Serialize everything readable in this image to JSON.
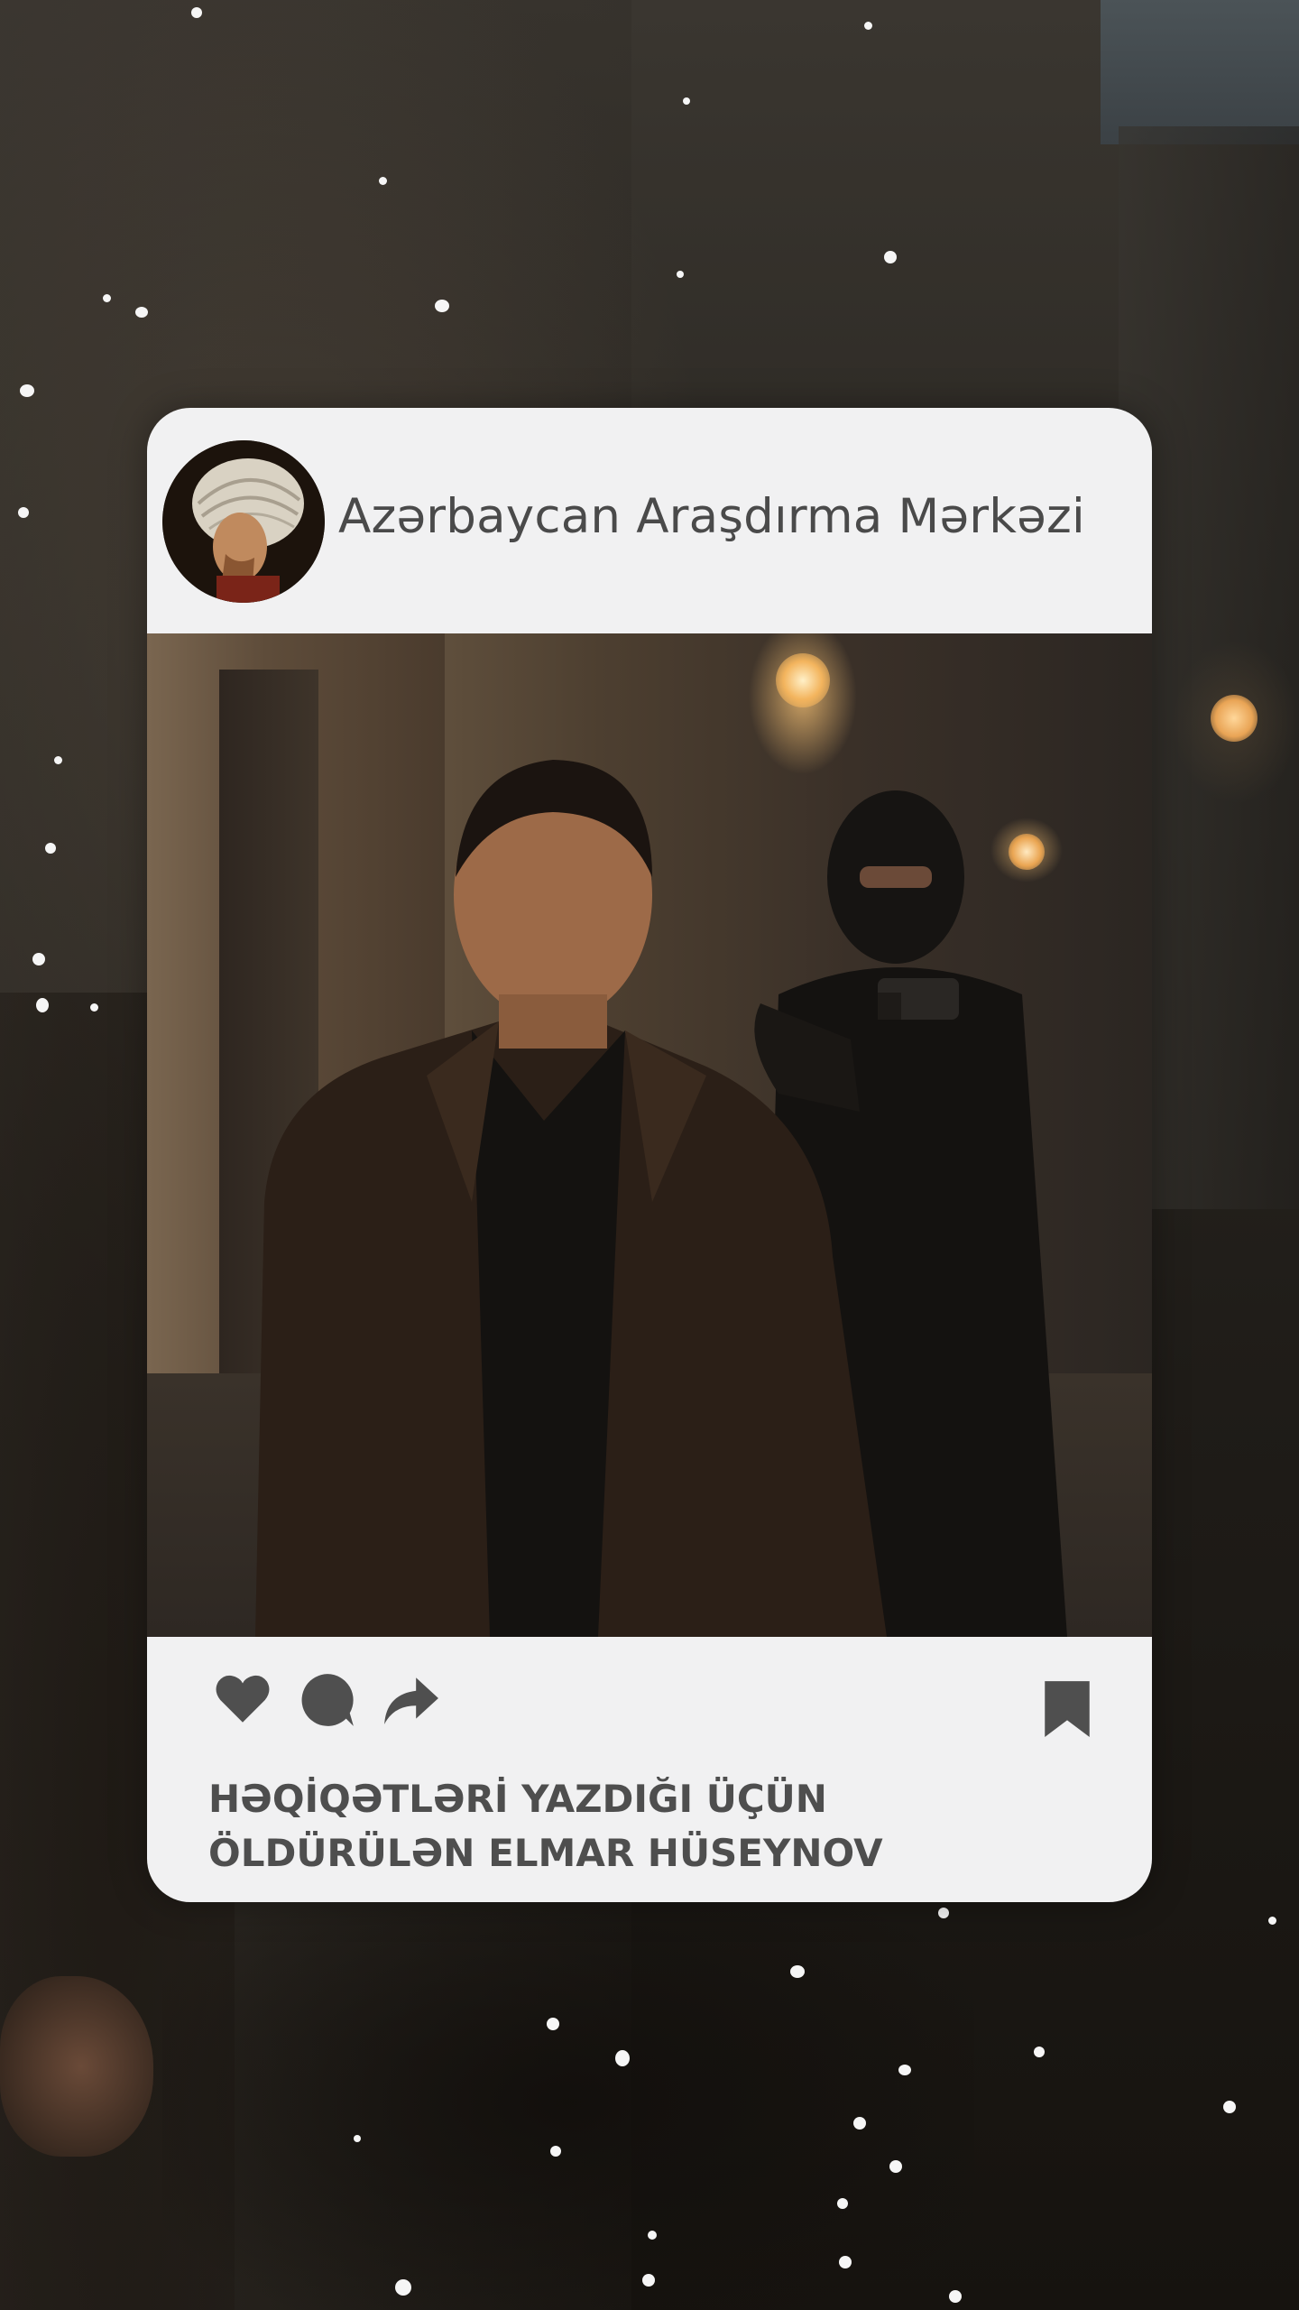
{
  "post": {
    "account_name": "Azərbaycan Araşdırma Mərkəzi",
    "caption_line1": "HƏQİQƏTLƏRİ YAZDIĞI ÜÇÜN",
    "caption_line2": "ÖLDÜRÜLƏN ELMAR HÜSEYNOV"
  },
  "icons": {
    "like": "heart-icon",
    "comment": "comment-icon",
    "share": "share-icon",
    "save": "bookmark-icon"
  },
  "colors": {
    "card_background": "#f1f1f2",
    "text": "#4a4a4a",
    "icon": "#4f4f4f"
  }
}
